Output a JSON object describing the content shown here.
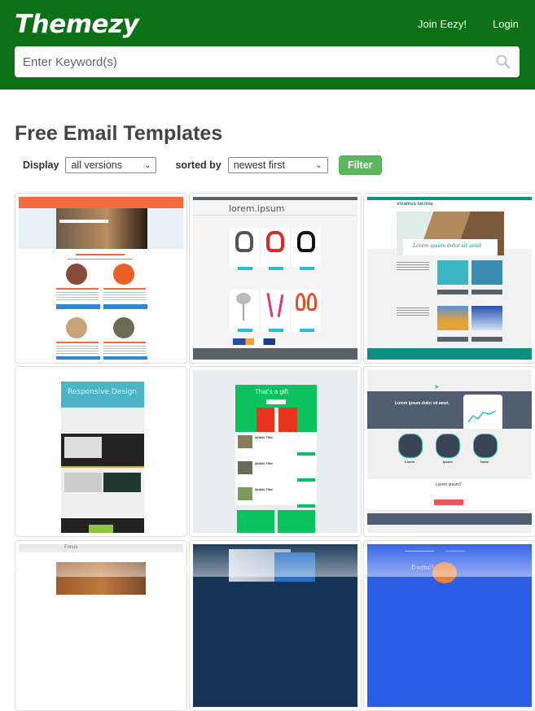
{
  "header": {
    "logo": "Themezy",
    "nav": [
      {
        "label": "Join Eezy!"
      },
      {
        "label": "Login"
      }
    ],
    "search": {
      "placeholder": "Enter Keyword(s)",
      "value": "",
      "icon": "search-icon"
    },
    "brand_color": "#0d7017"
  },
  "main": {
    "title": "Free Email Templates",
    "filters": {
      "display_label": "Display",
      "display_value": "all versions",
      "sort_label": "sorted by",
      "sort_value": "newest first",
      "filter_button": "Filter",
      "button_color": "#5cb85c"
    },
    "templates": [
      {
        "name": "orange-header-lifestyle-template",
        "theme": "#f26a3d"
      },
      {
        "name": "lorem-ipsum-headphones-template",
        "logo_text": "lorem.ipsum",
        "theme": "#2bbcd4"
      },
      {
        "name": "vivamus-lacinia-travel-template",
        "logo_text": "vivamus lacinia",
        "headline": "Lorem ipsum dolor sit amet",
        "theme": "#0e8f83"
      },
      {
        "name": "responsive-design-template",
        "headline": "Responsive Design",
        "theme": "#4fb3c8"
      },
      {
        "name": "gift-green-template",
        "headline": "That's a gift",
        "article_title": "Article Title",
        "theme": "#0bc25e"
      },
      {
        "name": "app-landing-template",
        "headline": "Lorem ipsum dolor sit amet.",
        "cta_heading": "Lorem ipsum?",
        "features": [
          "Lorem",
          "Ipsum",
          "Dolor"
        ],
        "theme": "#515d70"
      },
      {
        "name": "focus-fashion-template",
        "logo_text": "Focus",
        "theme": "#e8e8e8"
      },
      {
        "name": "medical-doctor-template",
        "theme": "#153456"
      },
      {
        "name": "science-kid-template",
        "theme": "#2d5ee6"
      }
    ]
  }
}
